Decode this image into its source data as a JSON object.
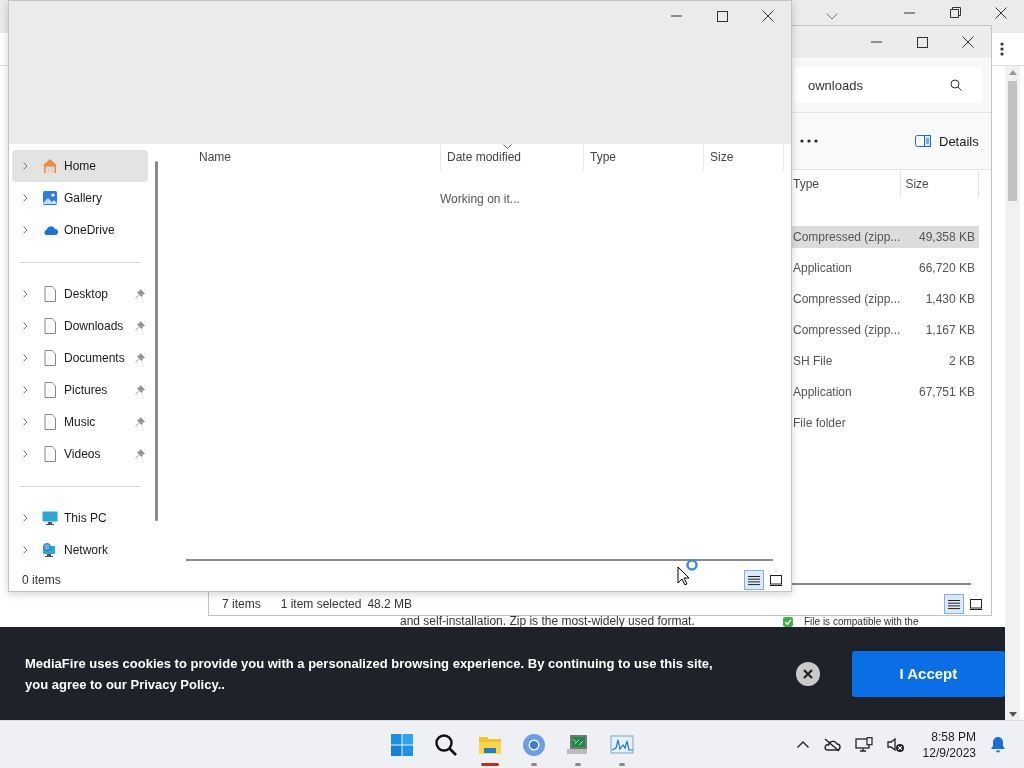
{
  "browser_page": {
    "paragraph": "and self-installation. Zip is the most-widely used format.",
    "compat_note": "File is compatible with the"
  },
  "back_window": {
    "search": {
      "value": "ownloads"
    },
    "view_button": "Details",
    "columns": [
      "Type",
      "Size"
    ],
    "rows": [
      {
        "type": "Compressed (zipp...",
        "size": "49,358 KB",
        "selected": true
      },
      {
        "type": "Application",
        "size": "66,720 KB",
        "selected": false
      },
      {
        "type": "Compressed (zipp...",
        "size": "1,430 KB",
        "selected": false
      },
      {
        "type": "Compressed (zipp...",
        "size": "1,167 KB",
        "selected": false
      },
      {
        "type": "SH File",
        "size": "2 KB",
        "selected": false
      },
      {
        "type": "Application",
        "size": "67,751 KB",
        "selected": false
      },
      {
        "type": "File folder",
        "selected": false
      }
    ],
    "status": {
      "count": "7 items",
      "selection": "1 item selected",
      "selection_size": "48.2 MB"
    },
    "view_modes": [
      {
        "kind": "details",
        "selected": true
      },
      {
        "kind": "tiles",
        "selected": false
      }
    ]
  },
  "front_window": {
    "nav": {
      "groups": [
        {
          "items": [
            {
              "label": "Home",
              "kind": "home",
              "pinned": false,
              "selected": true
            },
            {
              "label": "Gallery",
              "kind": "gallery",
              "pinned": false,
              "selected": false
            },
            {
              "label": "OneDrive",
              "kind": "cloud",
              "pinned": false,
              "selected": false
            }
          ]
        },
        {
          "items": [
            {
              "label": "Desktop",
              "kind": "file",
              "pinned": true,
              "selected": false
            },
            {
              "label": "Downloads",
              "kind": "file",
              "pinned": true,
              "selected": false
            },
            {
              "label": "Documents",
              "kind": "file",
              "pinned": true,
              "selected": false
            },
            {
              "label": "Pictures",
              "kind": "file",
              "pinned": true,
              "selected": false
            },
            {
              "label": "Music",
              "kind": "file",
              "pinned": true,
              "selected": false
            },
            {
              "label": "Videos",
              "kind": "file",
              "pinned": true,
              "selected": false
            }
          ]
        },
        {
          "items": [
            {
              "label": "This PC",
              "kind": "pc",
              "pinned": false,
              "selected": false
            },
            {
              "label": "Network",
              "kind": "network",
              "pinned": false,
              "selected": false
            }
          ]
        }
      ]
    },
    "columns": [
      {
        "label": "Name",
        "sorted": false
      },
      {
        "label": "Date modified",
        "sorted": true
      },
      {
        "label": "Type",
        "sorted": false
      },
      {
        "label": "Size",
        "sorted": false
      }
    ],
    "message": "Working on it...",
    "status": "0 items",
    "view_modes": [
      {
        "kind": "details",
        "selected": true
      },
      {
        "kind": "tiles",
        "selected": false
      }
    ]
  },
  "cookie_banner": {
    "text": "MediaFire uses cookies to provide you with a personalized browsing experience. By continuing to use this site, you agree to our Privacy Policy..",
    "button": "I Accept"
  },
  "taskbar": {
    "apps": [
      {
        "kind": "start",
        "running": false,
        "active": false
      },
      {
        "kind": "search",
        "running": false,
        "active": false
      },
      {
        "kind": "explorer",
        "running": true,
        "active": true
      },
      {
        "kind": "browser",
        "running": true,
        "active": false
      },
      {
        "kind": "terminal",
        "running": true,
        "active": false
      },
      {
        "kind": "monitor",
        "running": true,
        "active": false
      }
    ],
    "time": "8:58 PM",
    "date": "12/9/2023"
  }
}
